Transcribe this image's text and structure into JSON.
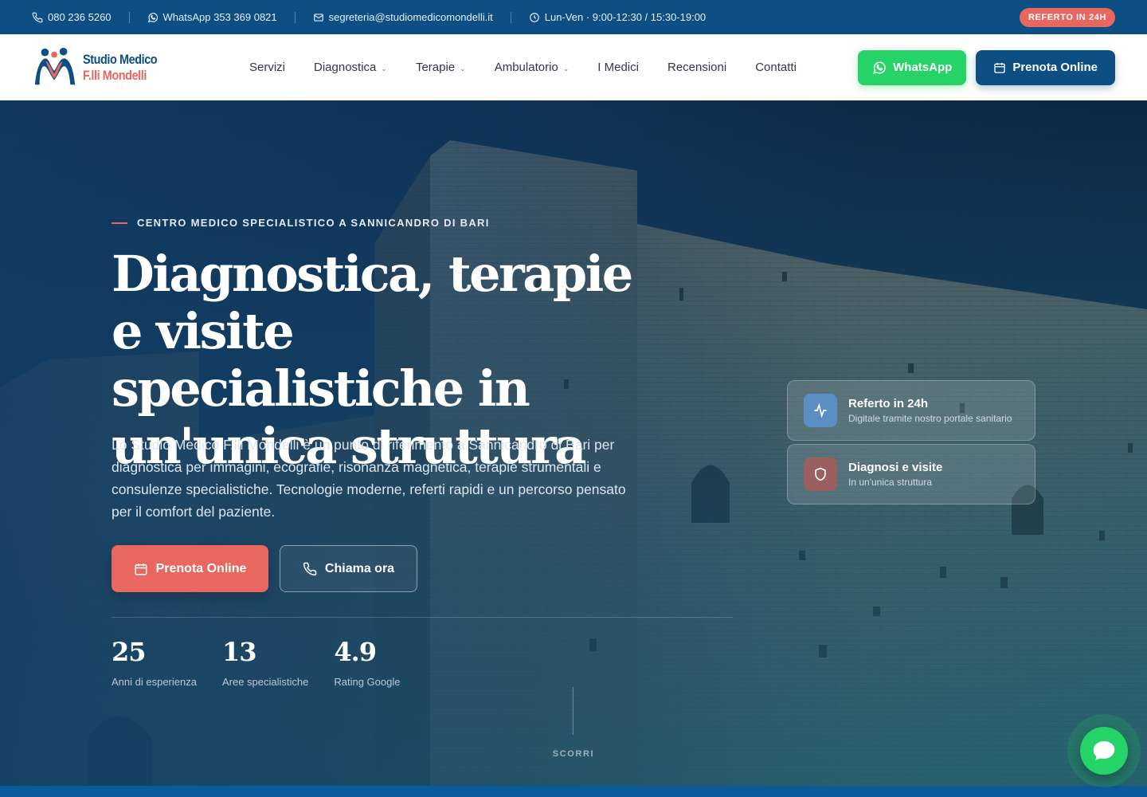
{
  "topbar": {
    "phone": "080 236 5260",
    "whatsapp": "WhatsApp 353 369 0821",
    "email": "segreteria@studiomedicomondelli.it",
    "hours": "Lun-Ven · 9:00-12:30 / 15:30-19:00",
    "badge": "REFERTO IN 24H"
  },
  "header": {
    "logo_line1": "Studio Medico",
    "logo_line2": "F.lli Mondelli",
    "nav": {
      "servizi": "Servizi",
      "diagnostica": "Diagnostica",
      "terapie": "Terapie",
      "ambulatorio": "Ambulatorio",
      "medici": "I Medici",
      "recensioni": "Recensioni",
      "contatti": "Contatti"
    },
    "caret": "⌄",
    "whatsapp_button": "WhatsApp",
    "book_button": "Prenota Online"
  },
  "hero": {
    "eyebrow": "CENTRO MEDICO SPECIALISTICO A SANNICANDRO DI BARI",
    "title": "Diagnostica, terapie e visite specialistiche in un'unica struttura",
    "description": "Lo Studio Medico F.lli Mondelli è un punto di riferimento a Sannicandro di Bari per diagnostica per immagini, ecografie, risonanza magnetica, terapie strumentali e consulenze specialistiche. Tecnologie moderne, referti rapidi e un percorso pensato per il comfort del paziente.",
    "primary_button": "Prenota Online",
    "secondary_button": "Chiama ora",
    "stats": [
      {
        "value": "25",
        "label": "Anni di esperienza"
      },
      {
        "value": "13",
        "label": "Aree specialistiche"
      },
      {
        "value": "4.9",
        "label": "Rating Google"
      }
    ],
    "scroll_label": "SCORRI"
  },
  "cards": [
    {
      "title": "Referto in 24h",
      "subtitle": "Digitale tramite nostro portale sanitario",
      "icon": "activity-icon"
    },
    {
      "title": "Diagnosi e visite",
      "subtitle": "In un'unica struttura",
      "icon": "shield-icon"
    }
  ],
  "colors": {
    "brand_blue": "#0d4f82",
    "accent_coral": "#e8675f",
    "whatsapp_green": "#25d366"
  }
}
